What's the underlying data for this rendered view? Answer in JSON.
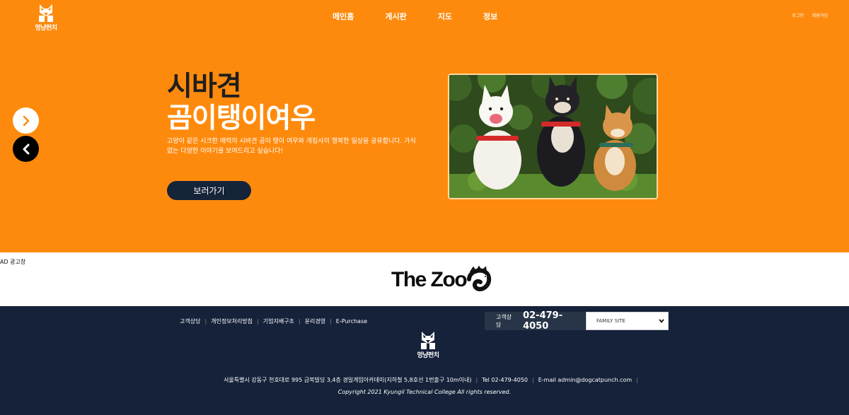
{
  "brand": {
    "logo_text": "멍냥펀치"
  },
  "nav": {
    "items": [
      "메인홈",
      "게시판",
      "지도",
      "정보"
    ]
  },
  "util": {
    "login": "로그인",
    "separator": "·",
    "signup": "회원가입"
  },
  "hero": {
    "title": "시바견",
    "subtitle": "곰이탱이여우",
    "description": "고양이 같은 시크한 매력의 시바견 곰이 탱이 여우와 개집사의 행복한 일상을 공유합니다. 가식없는 다양한 이야기를 보여드리고 싶습니다!",
    "cta_label": "보러가기",
    "background_color": "#fe8a0d",
    "cta_color": "#16243a"
  },
  "ad": {
    "label": "AD 광고창",
    "logo_text": "The Zoo"
  },
  "footer": {
    "links": [
      "고객상담",
      "개인정보처리방침",
      "기업지배구조",
      "윤리경영",
      "E-Purchase"
    ],
    "link_separator": "|",
    "cs_label": "고객상담",
    "cs_number": "02-479-4050",
    "family_site": "FAMILY SITE",
    "logo_text": "멍냥펀치",
    "address": "서울특별시 강동구 천호대로 995 금복빌딩 3,4층 경일게임아카데미(지하철 5,8호선 1번출구 10m이내)",
    "tel": "Tel 02-479-4050",
    "email": "E-mail admin@dogcatpunch.com",
    "info_separator": "|",
    "copyright": "Copyright 2021 Kyungil Technical College All rights reserved.",
    "background_color": "#15223a"
  }
}
